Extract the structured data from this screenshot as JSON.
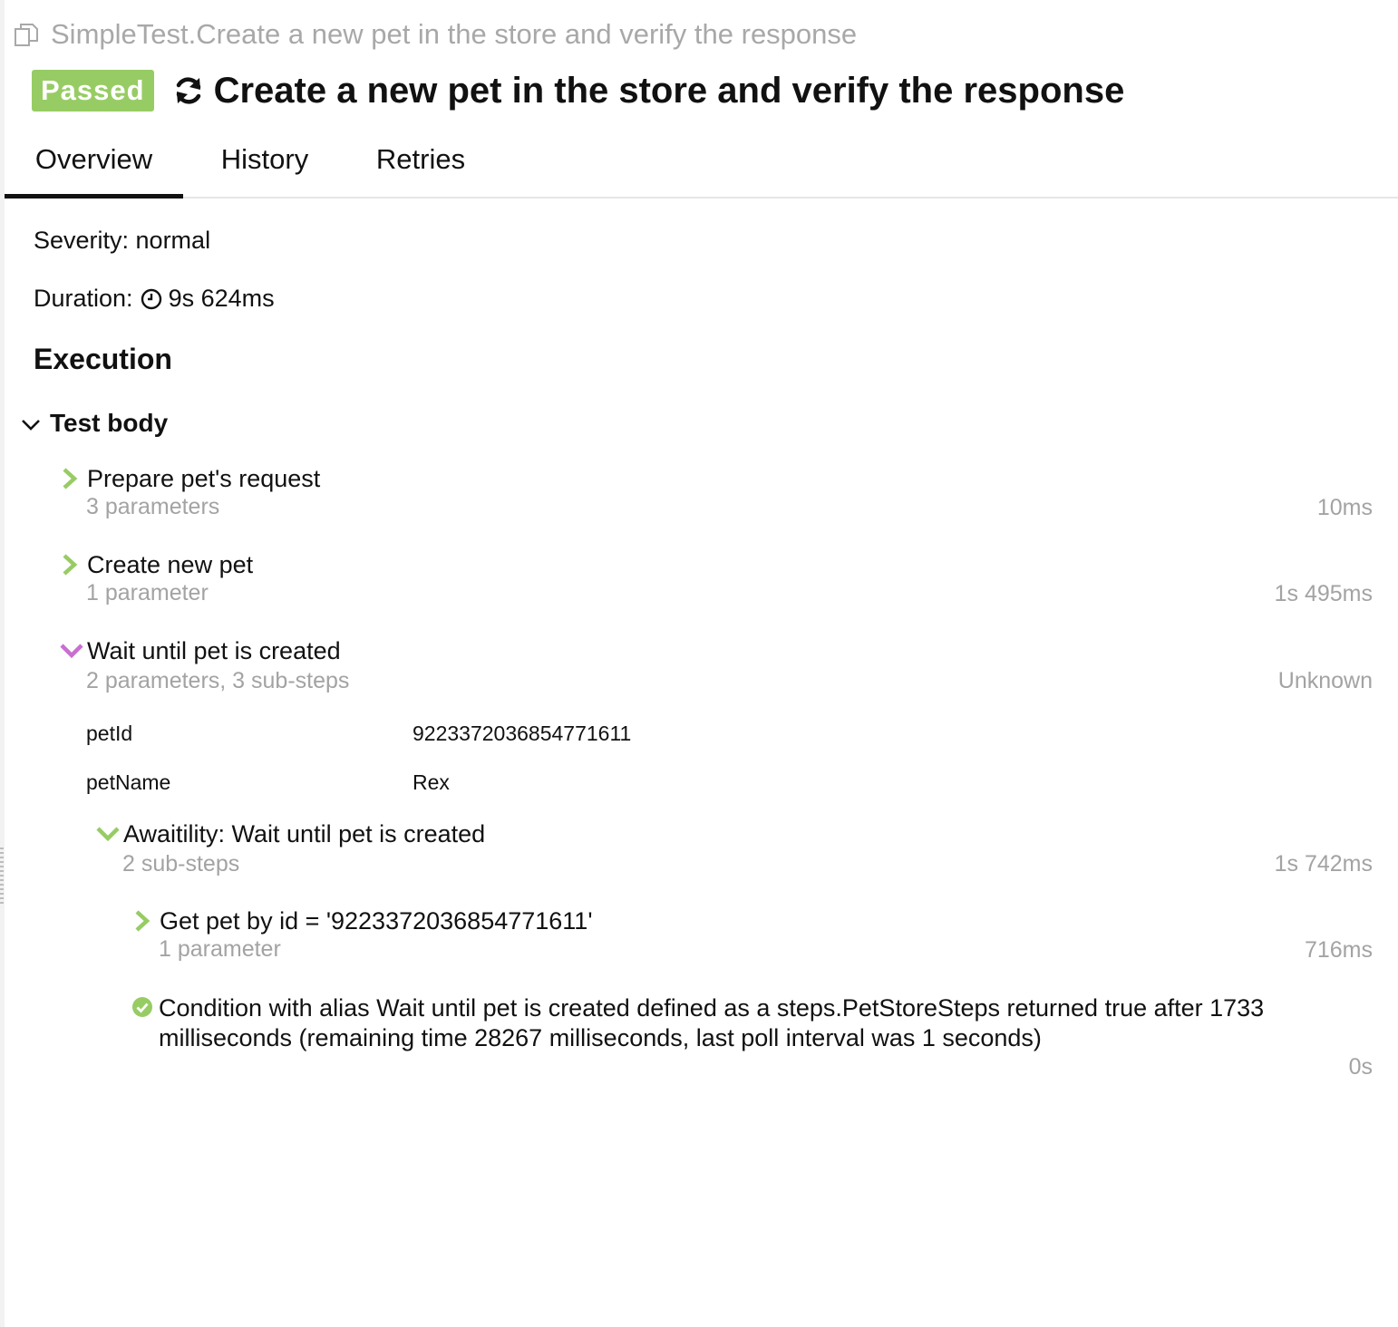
{
  "breadcrumb": {
    "text": "SimpleTest.Create a new pet in the store and verify the response",
    "icon": "copy-icon"
  },
  "header": {
    "status": "Passed",
    "status_color": "#97cc64",
    "retry_icon": "retry-icon",
    "title": "Create a new pet in the store and verify the response"
  },
  "tabs": [
    {
      "label": "Overview",
      "active": true
    },
    {
      "label": "History",
      "active": false
    },
    {
      "label": "Retries",
      "active": false
    }
  ],
  "overview": {
    "severity": "Severity: normal",
    "duration_label": "Duration:",
    "duration_value": "9s 624ms",
    "section_title": "Execution",
    "test_body": "Test body"
  },
  "steps": [
    {
      "name": "Prepare pet's request",
      "sub": "3 parameters",
      "duration": "10ms",
      "icon": "chevron-right-icon",
      "expanded": false
    },
    {
      "name": "Create new pet",
      "sub": "1 parameter",
      "duration": "1s 495ms",
      "icon": "chevron-right-icon",
      "expanded": false
    },
    {
      "name": "Wait until pet is created",
      "sub": "2 parameters, 3 sub-steps",
      "duration": "Unknown",
      "icon": "chevron-down-icon",
      "icon_color": "#c86fd1",
      "expanded": true,
      "parameters": [
        {
          "name": "petId",
          "value": "9223372036854771611"
        },
        {
          "name": "petName",
          "value": "Rex"
        }
      ],
      "children": [
        {
          "name": "Awaitility: Wait until pet is created",
          "sub": "2 sub-steps",
          "duration": "1s 742ms",
          "icon": "chevron-down-icon",
          "expanded": true,
          "children": [
            {
              "name": "Get pet by id = '9223372036854771611'",
              "sub": "1 parameter",
              "duration": "716ms",
              "icon": "chevron-right-icon"
            },
            {
              "name": "Condition with alias Wait until pet is created defined as a steps.PetStoreSteps returned true after 1733 milliseconds (remaining time 28267 milliseconds, last poll interval was 1 seconds)",
              "duration": "0s",
              "icon": "check-circle-icon"
            }
          ]
        }
      ]
    }
  ],
  "colors": {
    "passed": "#97cc64",
    "muted": "#a3a3a3",
    "broken_chevron": "#c86fd1"
  }
}
